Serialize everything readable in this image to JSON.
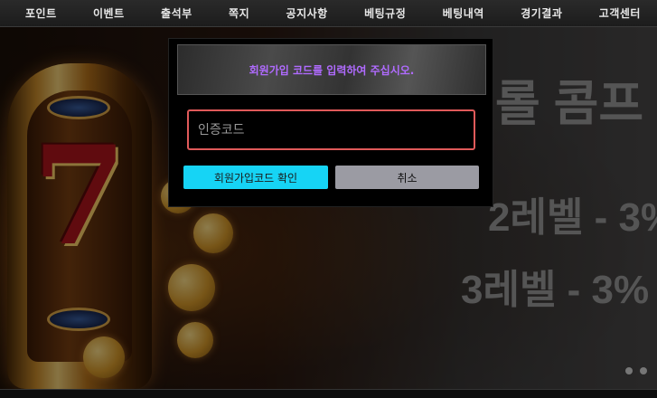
{
  "nav": {
    "items": [
      {
        "label": "포인트"
      },
      {
        "label": "이벤트"
      },
      {
        "label": "출석부"
      },
      {
        "label": "쪽지"
      },
      {
        "label": "공지사항"
      },
      {
        "label": "베팅규정"
      },
      {
        "label": "베팅내역"
      },
      {
        "label": "경기결과"
      },
      {
        "label": "고객센터"
      }
    ]
  },
  "banner": {
    "title": "롤 콤프",
    "line1": "2레벨 - 3%",
    "line2": "3레벨 - 3%",
    "slot_symbol": "7"
  },
  "modal": {
    "title": "회원가입 코드를 입력하여 주십시오.",
    "input": {
      "value": "",
      "placeholder": "인증코드"
    },
    "confirm_label": "회원가입코드 확인",
    "cancel_label": "취소"
  },
  "colors": {
    "accent_cyan": "#16d4f5",
    "title_purple": "#b06bff",
    "input_border": "#e05a5a",
    "cancel_gray": "#9b9ba3"
  },
  "icons": [
    "slot-machine-icon",
    "coin-icon"
  ]
}
